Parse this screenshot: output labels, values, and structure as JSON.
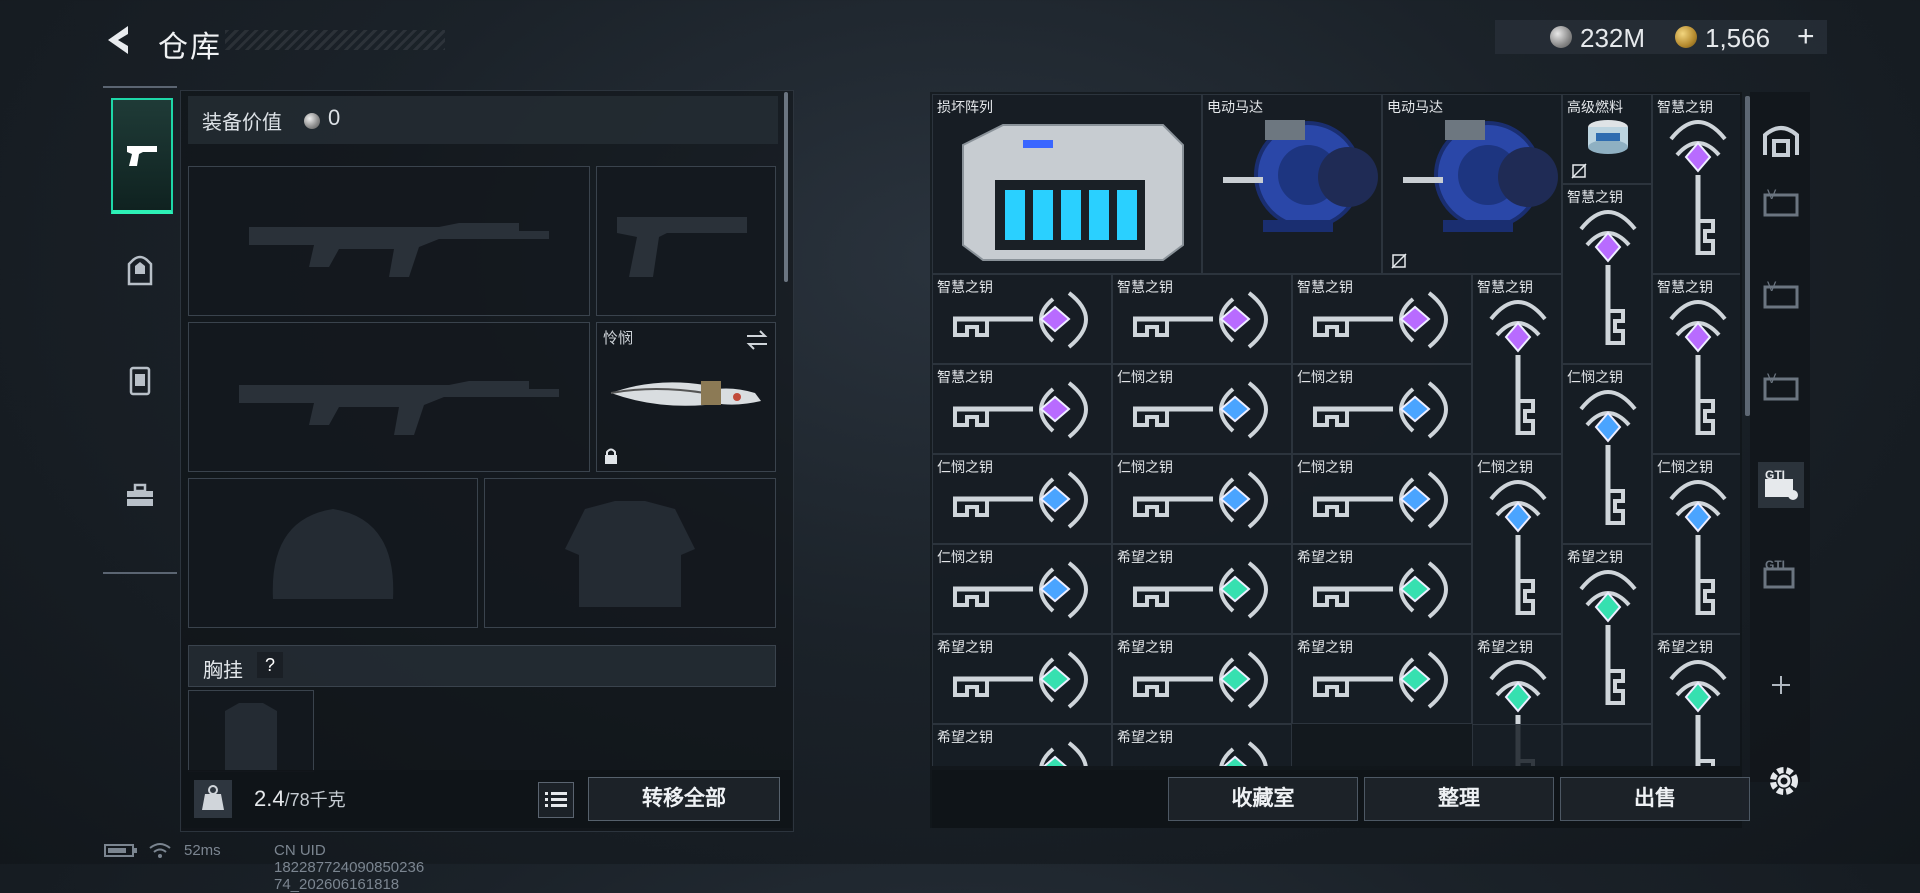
{
  "header": {
    "title": "仓库",
    "back_icon": "back-arrow-icon"
  },
  "currency": {
    "silver": "232M",
    "gold": "1,566",
    "add_label": "+"
  },
  "left_nav": {
    "tabs": [
      "pistol-icon",
      "backpack-icon",
      "armor-icon",
      "toolbox-icon"
    ],
    "selected": "pistol-icon"
  },
  "loadout": {
    "equip_value_label": "装备价值",
    "equip_value": "0",
    "melee_name": "怜悯",
    "chest_rig_label": "胸挂",
    "chest_rig_help": "?"
  },
  "weight": {
    "current": "2.4",
    "max": "/78千克"
  },
  "buttons": {
    "transfer_all": "转移全部",
    "collection": "收藏室",
    "sort": "整理",
    "sell": "出售"
  },
  "storage_items": [
    {
      "name": "损坏阵列"
    },
    {
      "name": "电动马达"
    },
    {
      "name": "电动马达",
      "marked": true
    },
    {
      "name": "高级燃料",
      "marked": true
    },
    {
      "name": "智慧之钥"
    },
    {
      "name": "智慧之钥"
    },
    {
      "name": "智慧之钥"
    },
    {
      "name": "智慧之钥"
    },
    {
      "name": "智慧之钥"
    },
    {
      "name": "智慧之钥"
    },
    {
      "name": "智慧之钥"
    },
    {
      "name": "智慧之钥"
    },
    {
      "name": "仁悯之钥"
    },
    {
      "name": "仁悯之钥"
    },
    {
      "name": "仁悯之钥"
    },
    {
      "name": "仁悯之钥"
    },
    {
      "name": "仁悯之钥"
    },
    {
      "name": "仁悯之钥"
    },
    {
      "name": "仁悯之钥"
    },
    {
      "name": "仁悯之钥"
    },
    {
      "name": "仁悯之钥"
    },
    {
      "name": "希望之钥"
    },
    {
      "name": "希望之钥"
    },
    {
      "name": "希望之钥"
    },
    {
      "name": "希望之钥"
    },
    {
      "name": "希望之钥"
    },
    {
      "name": "希望之钥"
    },
    {
      "name": "希望之钥"
    },
    {
      "name": "希望之钥"
    },
    {
      "name": "希望之钥"
    },
    {
      "name": "希望之钥"
    }
  ],
  "right_tabs": [
    "vault-icon",
    "storage-v1-icon",
    "storage-v2-icon",
    "storage-v3-icon",
    "storage-gti-active-icon",
    "storage-gti-icon",
    "add-storage-icon"
  ],
  "status": {
    "latency": "52ms",
    "uid": "CN UID 182287724090850236 74_202606161818"
  },
  "colors": {
    "accent": "#2df0b6",
    "wisdom_gem": "#b86bff",
    "mercy_gem": "#4aa4ff",
    "hope_gem": "#36e0b0"
  }
}
